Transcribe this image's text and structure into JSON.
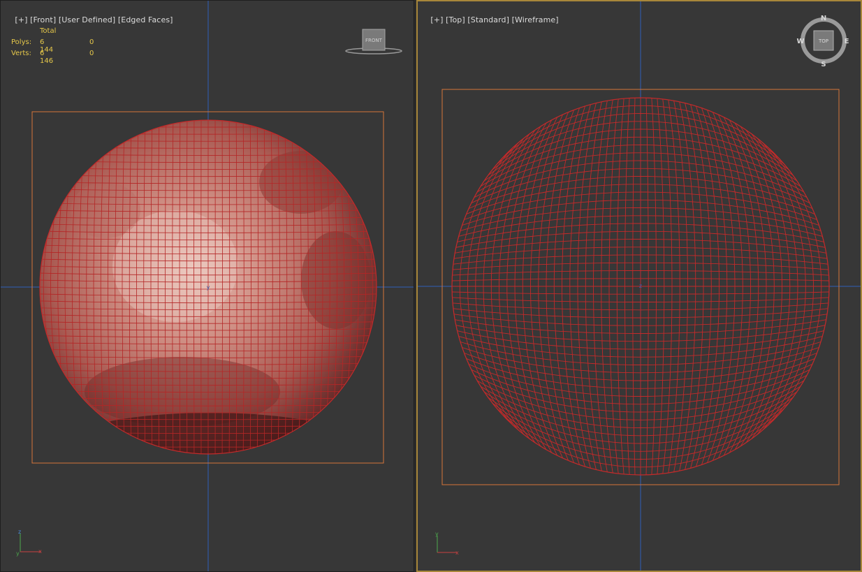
{
  "left_viewport": {
    "label": {
      "plus": "[+]",
      "view": "[Front]",
      "shading": "[User Defined]",
      "mode": "[Edged Faces]"
    },
    "stats": {
      "header": "Total",
      "polys_label": "Polys:",
      "polys_total": "6 144",
      "polys_selected": "0",
      "verts_label": "Verts:",
      "verts_total": "6 146",
      "verts_selected": "0"
    },
    "viewcube_label": "FRONT",
    "axis_labels": {
      "up": "z",
      "right": "x",
      "center": "y"
    }
  },
  "right_viewport": {
    "label": {
      "plus": "[+]",
      "view": "[Top]",
      "shading": "[Standard]",
      "mode": "[Wireframe]"
    },
    "viewcube_label": "TOP",
    "compass": {
      "n": "N",
      "s": "S",
      "e": "E",
      "w": "W"
    },
    "axis_labels": {
      "up": "y",
      "right": "x",
      "center": "z"
    }
  },
  "colors": {
    "viewport_bg": "#373737",
    "active_border": "#a8873a",
    "bbox": "#d4763a",
    "wire": "#c42a2a",
    "stats_text": "#e6c84a",
    "label_text": "#dcdcdc",
    "grid_axis": "#2f5fb8"
  }
}
